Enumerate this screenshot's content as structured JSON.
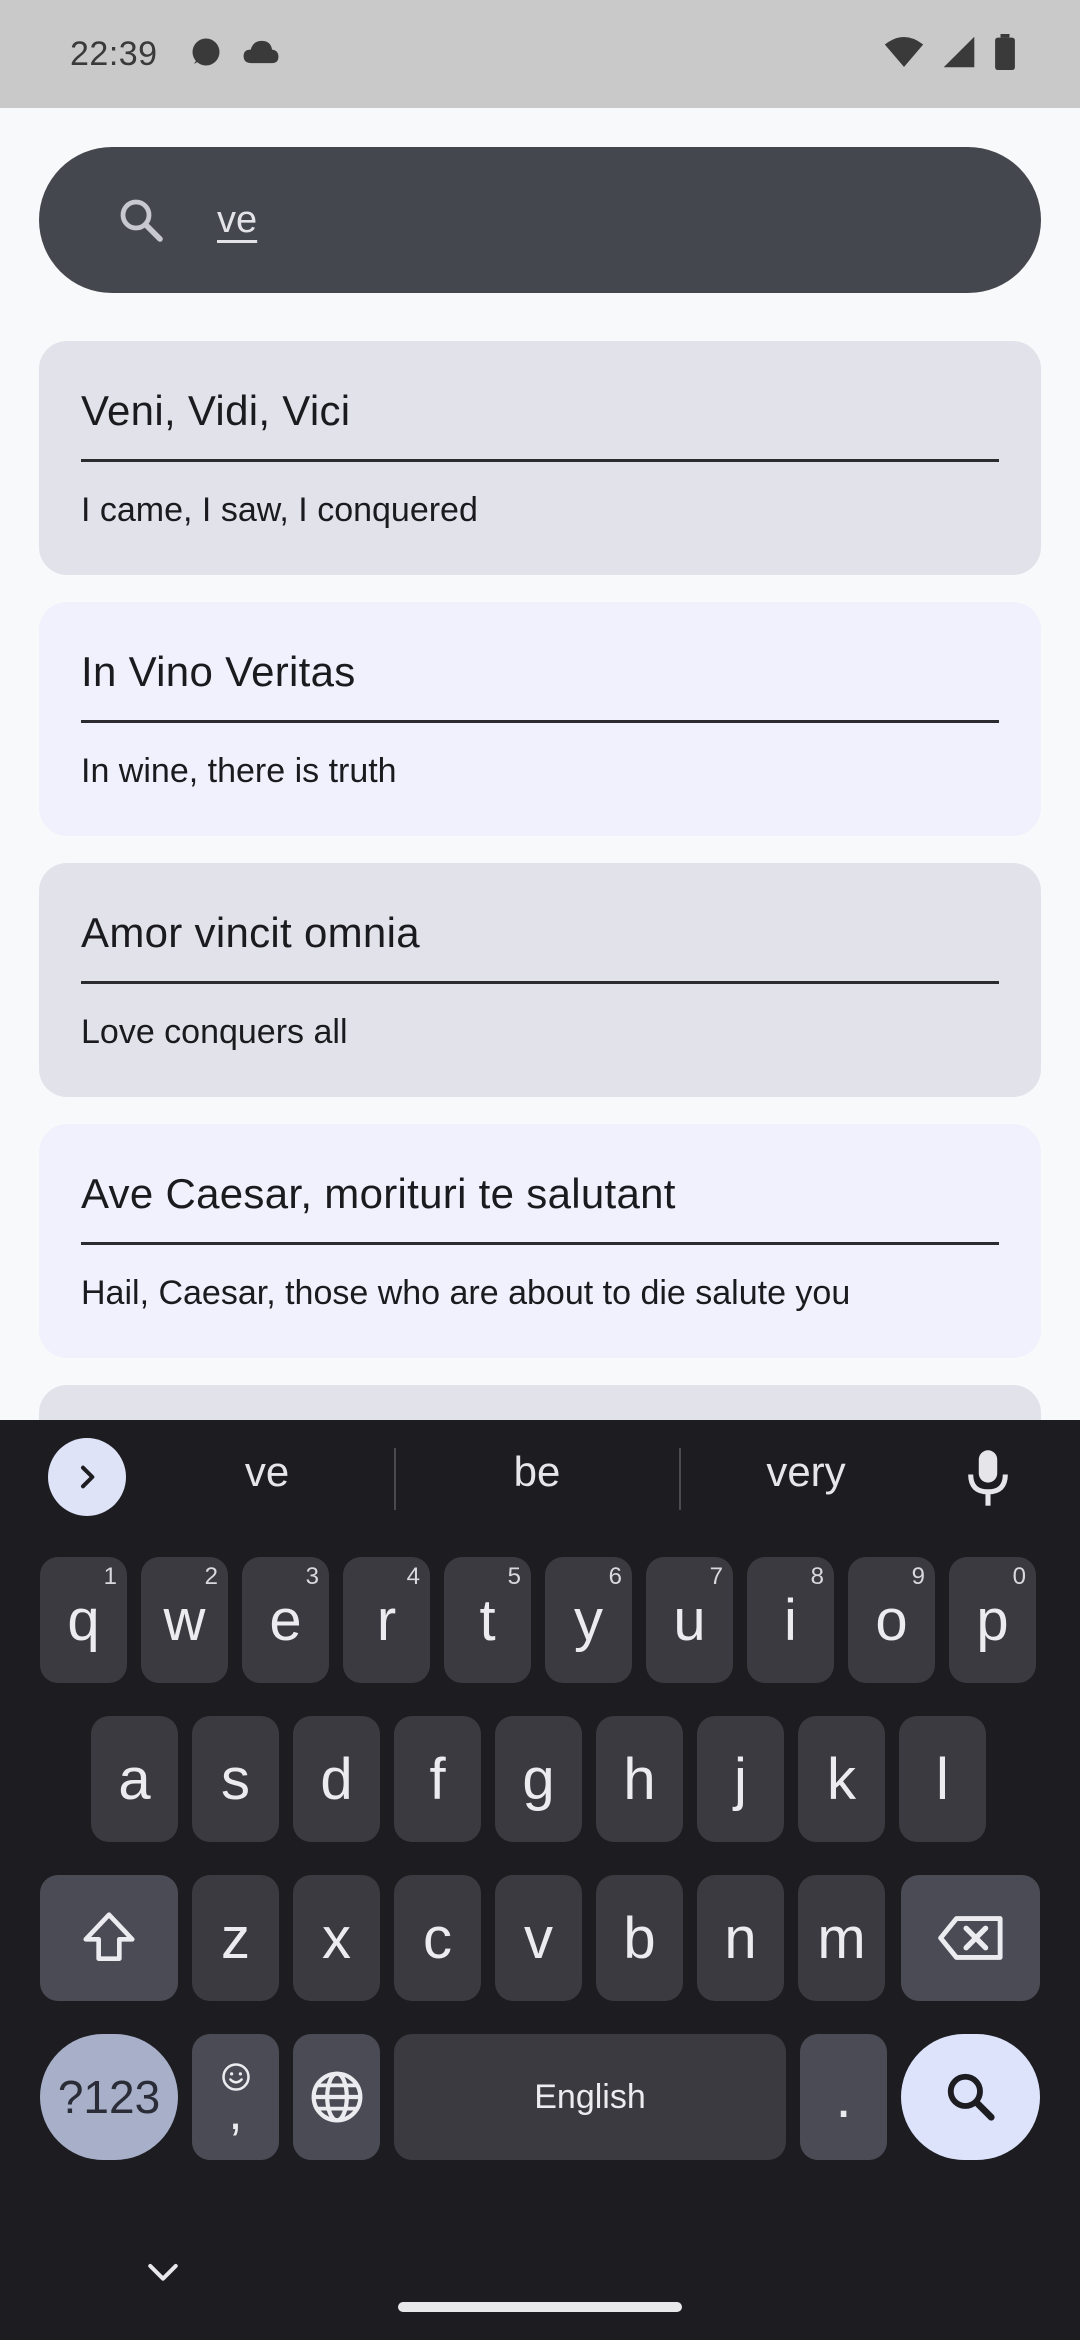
{
  "status_bar": {
    "time": "22:39",
    "left_icons": [
      "notification-bubble-icon",
      "cloud-icon"
    ],
    "right_icons": [
      "wifi-icon",
      "signal-icon",
      "battery-icon"
    ]
  },
  "search": {
    "value": "ve",
    "icon": "search-icon"
  },
  "results": [
    {
      "title": "Veni, Vidi, Vici",
      "translation": "I came, I saw, I conquered"
    },
    {
      "title": "In Vino Veritas",
      "translation": "In wine, there is truth"
    },
    {
      "title": "Amor vincit omnia",
      "translation": "Love conquers all"
    },
    {
      "title": "Ave Caesar, morituri te salutant",
      "translation": "Hail, Caesar, those who are about to die salute you"
    }
  ],
  "keyboard": {
    "suggestions": [
      "ve",
      "be",
      "very"
    ],
    "row1": [
      {
        "key": "q",
        "hint": "1"
      },
      {
        "key": "w",
        "hint": "2"
      },
      {
        "key": "e",
        "hint": "3"
      },
      {
        "key": "r",
        "hint": "4"
      },
      {
        "key": "t",
        "hint": "5"
      },
      {
        "key": "y",
        "hint": "6"
      },
      {
        "key": "u",
        "hint": "7"
      },
      {
        "key": "i",
        "hint": "8"
      },
      {
        "key": "o",
        "hint": "9"
      },
      {
        "key": "p",
        "hint": "0"
      }
    ],
    "row2": [
      "a",
      "s",
      "d",
      "f",
      "g",
      "h",
      "j",
      "k",
      "l"
    ],
    "row3": [
      "z",
      "x",
      "c",
      "v",
      "b",
      "n",
      "m"
    ],
    "symbols_label": "?123",
    "comma_label": ",",
    "space_label": "English",
    "period_label": ".",
    "colors": {
      "background": "#1c1c21",
      "key": "#3a3a40",
      "action": "#dce3fb"
    }
  }
}
